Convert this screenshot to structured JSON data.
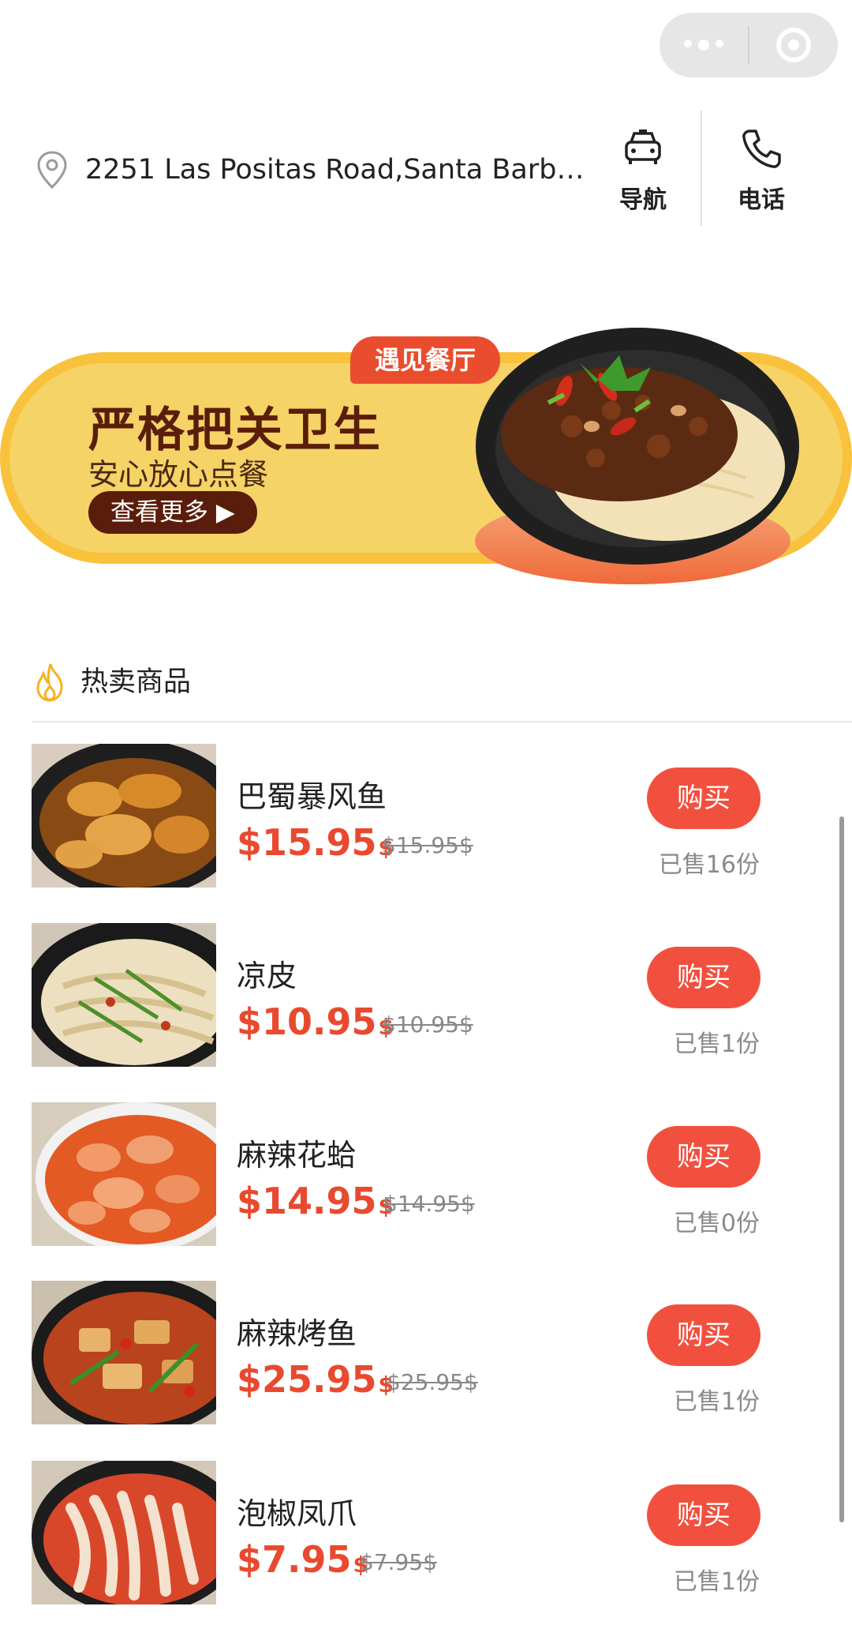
{
  "capsule": {
    "more_icon": "more-dots-icon",
    "close_icon": "target-close-icon"
  },
  "location": {
    "address": "2251 Las Positas Road,Santa Barba...",
    "icon": "location-pin-icon",
    "nav_label": "导航",
    "nav_icon": "car-icon",
    "call_label": "电话",
    "call_icon": "phone-icon"
  },
  "banner": {
    "tag": "遇见餐厅",
    "headline": "严格把关卫生",
    "subline": "安心放心点餐",
    "more_label": "查看更多 ▶"
  },
  "section": {
    "title": "热卖商品",
    "icon": "flame-icon"
  },
  "colors": {
    "accent": "#f2503f",
    "price": "#e84a2f",
    "banner": "#f5d366",
    "banner_text": "#5a1d0b"
  },
  "products": [
    {
      "name": "巴蜀暴风鱼",
      "price": "$15.95",
      "currency": "$",
      "original": "$15.95$",
      "buy_label": "购买",
      "sold": "已售16份"
    },
    {
      "name": "凉皮",
      "price": "$10.95",
      "currency": "$",
      "original": "$10.95$",
      "buy_label": "购买",
      "sold": "已售1份"
    },
    {
      "name": "麻辣花蛤",
      "price": "$14.95",
      "currency": "$",
      "original": "$14.95$",
      "buy_label": "购买",
      "sold": "已售0份"
    },
    {
      "name": "麻辣烤鱼",
      "price": "$25.95",
      "currency": "$",
      "original": "$25.95$",
      "buy_label": "购买",
      "sold": "已售1份"
    },
    {
      "name": "泡椒凤爪",
      "price": "$7.95",
      "currency": "$",
      "original": "$7.95$",
      "buy_label": "购买",
      "sold": "已售1份"
    }
  ]
}
